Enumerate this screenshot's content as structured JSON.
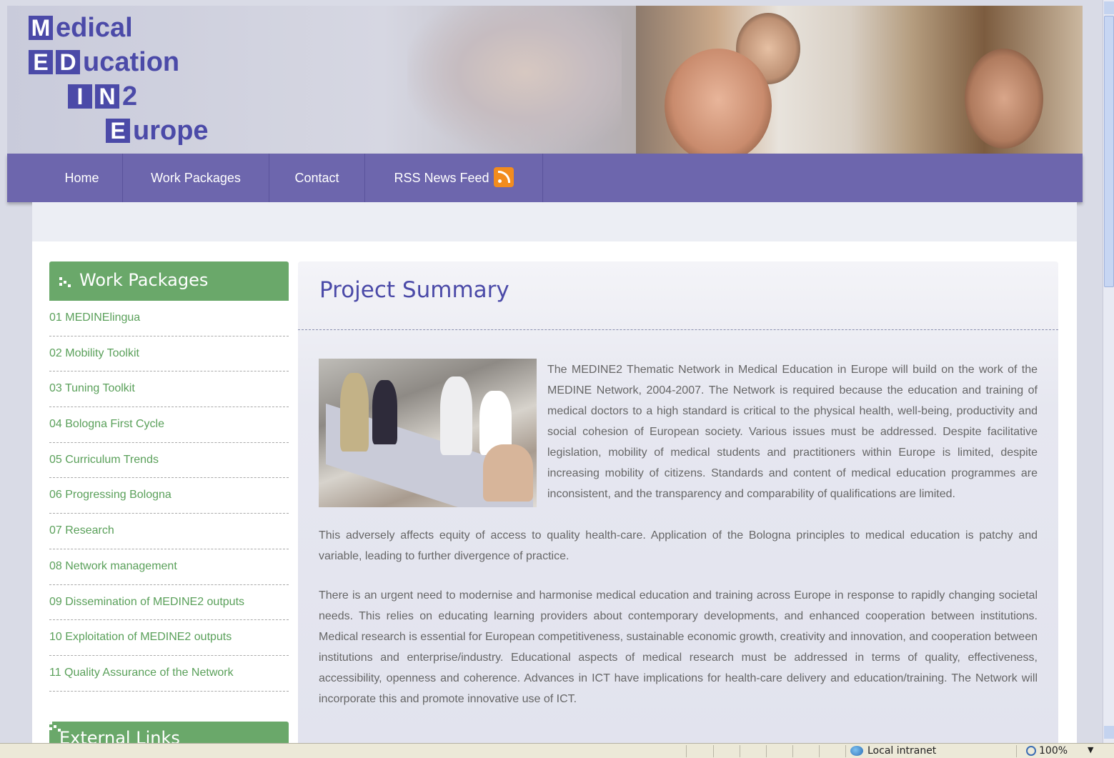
{
  "logo": {
    "rows": [
      {
        "box": "M",
        "text": "edical"
      },
      {
        "box1": "E",
        "box2": "D",
        "text": "ucation"
      },
      {
        "box1": "I",
        "box2": "N",
        "text": "2"
      },
      {
        "box": "E",
        "text": "urope"
      }
    ]
  },
  "nav": {
    "items": [
      {
        "label": "Home"
      },
      {
        "label": "Work Packages"
      },
      {
        "label": "Contact"
      },
      {
        "label": "RSS News Feed",
        "icon": "rss-icon"
      }
    ]
  },
  "sidebar": {
    "title": "Work Packages",
    "items": [
      "01 MEDINElingua",
      "02 Mobility Toolkit",
      "03 Tuning Toolkit",
      "04 Bologna First Cycle",
      "05 Curriculum Trends",
      "06 Progressing Bologna",
      "07 Research",
      "08 Network management",
      "09 Dissemination of MEDINE2 outputs",
      "10 Exploitation of MEDINE2 outputs",
      "11 Quality Assurance of the Network"
    ],
    "title2": "External Links"
  },
  "main": {
    "title": "Project Summary",
    "p1a": "The MEDINE2 Thematic Network in Medical Education in Europe will build on the work of the MEDINE Network, 2004-2007. The Network is required because the education and training of medical doctors to a high standard is critical to the physical health, well-being, productivity and social cohesion of European society. Various issues must be addressed. Despite facilitative legislation, mobility of medical students and practitioners within Europe is limited, despite increasing mobility of citizens. Standards and content of medical education programmes are inconsistent, and the transparency and comparability of qualifications are limited.",
    "p1b": "This adversely affects equity of access to quality health-care. Application of the Bologna principles to medical education is patchy and variable, leading to further divergence of practice.",
    "p2": "There is an urgent need to modernise and harmonise medical education and training across Europe in response to rapidly changing societal needs. This relies on educating learning providers about contemporary developments, and enhanced cooperation between institutions. Medical research is essential for European competitiveness, sustainable economic growth, creativity and innovation, and cooperation between institutions and enterprise/industry. Educational aspects of medical research must be addressed in terms of quality, effectiveness, accessibility, openness and coherence. Advances in ICT have implications for health-care delivery and education/training. The Network will incorporate this and promote innovative use of ICT."
  },
  "statusbar": {
    "zone": "Local intranet",
    "zoom": "100%"
  },
  "colors": {
    "brand": "#4b4aa8",
    "nav": "#6d66ad",
    "sidebar_head": "#6aa86a",
    "sidebar_link": "#5aa05a"
  }
}
